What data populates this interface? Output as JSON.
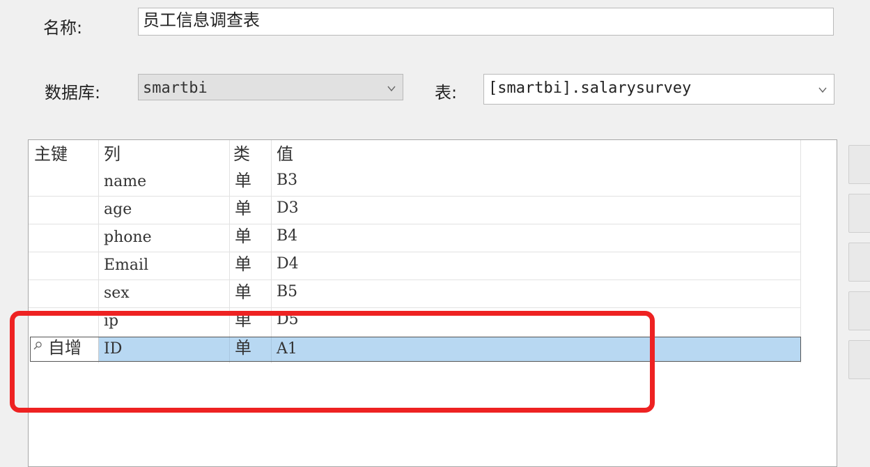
{
  "form": {
    "name_label": "名称:",
    "name_value": "员工信息调查表",
    "database_label": "数据库:",
    "database_value": "smartbi",
    "table_label": "表:",
    "table_value": "[smartbi].salarysurvey"
  },
  "grid": {
    "headers": [
      "主键",
      "列",
      "类",
      "值"
    ],
    "rows": [
      {
        "key": "",
        "column": "name",
        "type": "单",
        "value": "B3"
      },
      {
        "key": "",
        "column": "age",
        "type": "单",
        "value": "D3"
      },
      {
        "key": "",
        "column": "phone",
        "type": "单",
        "value": "B4"
      },
      {
        "key": "",
        "column": "Email",
        "type": "单",
        "value": "D4"
      },
      {
        "key": "",
        "column": "sex",
        "type": "单",
        "value": "B5"
      },
      {
        "key": "",
        "column": "ip",
        "type": "单",
        "value": "D5"
      },
      {
        "key": "自增",
        "column": "ID",
        "type": "单",
        "value": "A1",
        "selected": true,
        "key_icon": "magnifier-icon"
      }
    ]
  },
  "colors": {
    "selection": "#b8d8f2",
    "annotation": "#ee2222"
  }
}
